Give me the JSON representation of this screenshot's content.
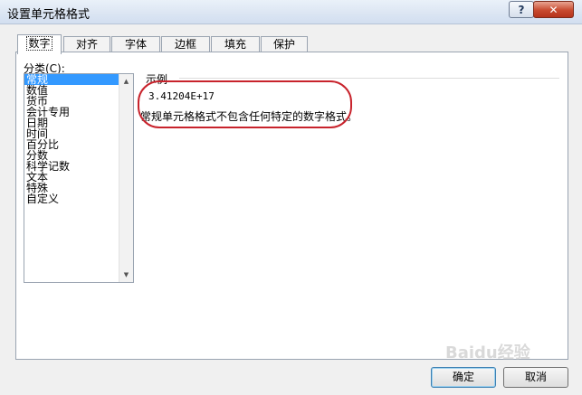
{
  "window": {
    "title": "设置单元格格式",
    "help_label": "?",
    "close_label": "✕"
  },
  "tabs": [
    {
      "label": "数字",
      "active": true
    },
    {
      "label": "对齐",
      "active": false
    },
    {
      "label": "字体",
      "active": false
    },
    {
      "label": "边框",
      "active": false
    },
    {
      "label": "填充",
      "active": false
    },
    {
      "label": "保护",
      "active": false
    }
  ],
  "category": {
    "label": "分类(C):",
    "items": [
      "常规",
      "数值",
      "货币",
      "会计专用",
      "日期",
      "时间",
      "百分比",
      "分数",
      "科学记数",
      "文本",
      "特殊",
      "自定义"
    ],
    "selected_index": 0
  },
  "sample": {
    "label": "示例",
    "value": "3.41204E+17"
  },
  "description": "常规单元格格式不包含任何特定的数字格式。",
  "buttons": {
    "ok": "确定",
    "cancel": "取消"
  },
  "watermark": "Baidu经验",
  "colors": {
    "annotation": "#c8232c",
    "selection": "#3399ff"
  }
}
